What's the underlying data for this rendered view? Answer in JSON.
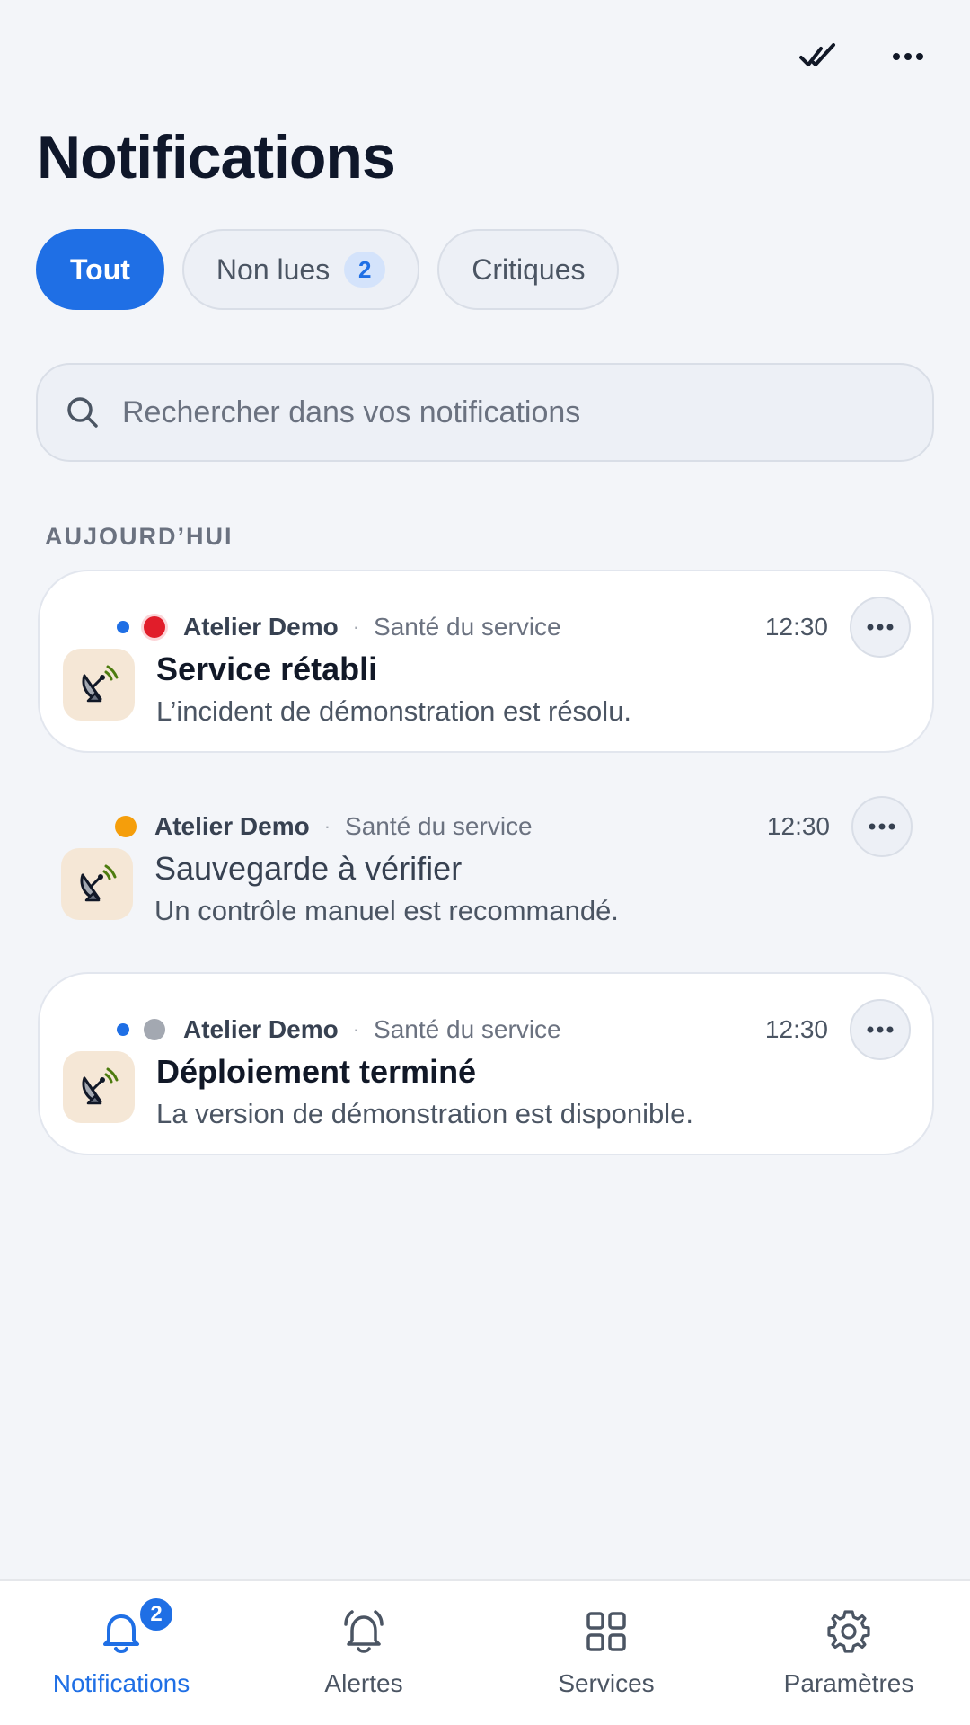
{
  "header": {
    "title": "Notifications",
    "actions": [
      {
        "name": "mark-all-read",
        "icon": "double-check-icon"
      },
      {
        "name": "more-options",
        "icon": "more-horizontal-icon"
      }
    ]
  },
  "filters": [
    {
      "label": "Tout",
      "active": true
    },
    {
      "label": "Non lues",
      "badge": "2",
      "active": false
    },
    {
      "label": "Critiques",
      "active": false
    }
  ],
  "search": {
    "placeholder": "Rechercher dans vos notifications",
    "value": ""
  },
  "section": {
    "label": "AUJOURD’HUI"
  },
  "notifications": [
    {
      "sender": "Atelier Demo",
      "category": "Santé du service",
      "time": "12:30",
      "title": "Service rétabli",
      "body": "L’incident de démonstration est résolu.",
      "unread": true,
      "severity_color": "#e11d2a",
      "icon": "satellite-dish-icon"
    },
    {
      "sender": "Atelier Demo",
      "category": "Santé du service",
      "time": "12:30",
      "title": "Sauvegarde à vérifier",
      "body": "Un contrôle manuel est recommandé.",
      "unread": false,
      "severity_color": "#f59e0b",
      "icon": "satellite-dish-icon"
    },
    {
      "sender": "Atelier Demo",
      "category": "Santé du service",
      "time": "12:30",
      "title": "Déploiement terminé",
      "body": "La version de démonstration est disponible.",
      "unread": true,
      "severity_color": "#a3a8b1",
      "icon": "satellite-dish-icon"
    }
  ],
  "bottom_nav": [
    {
      "label": "Notifications",
      "icon": "bell-icon",
      "badge": "2",
      "active": true
    },
    {
      "label": "Alertes",
      "icon": "bell-ringing-icon",
      "active": false
    },
    {
      "label": "Services",
      "icon": "grid-icon",
      "active": false
    },
    {
      "label": "Paramètres",
      "icon": "gear-icon",
      "active": false
    }
  ],
  "colors": {
    "accent": "#1f6fe5",
    "background": "#f3f5f9",
    "critical": "#e11d2a",
    "warning": "#f59e0b",
    "neutral": "#a3a8b1"
  }
}
